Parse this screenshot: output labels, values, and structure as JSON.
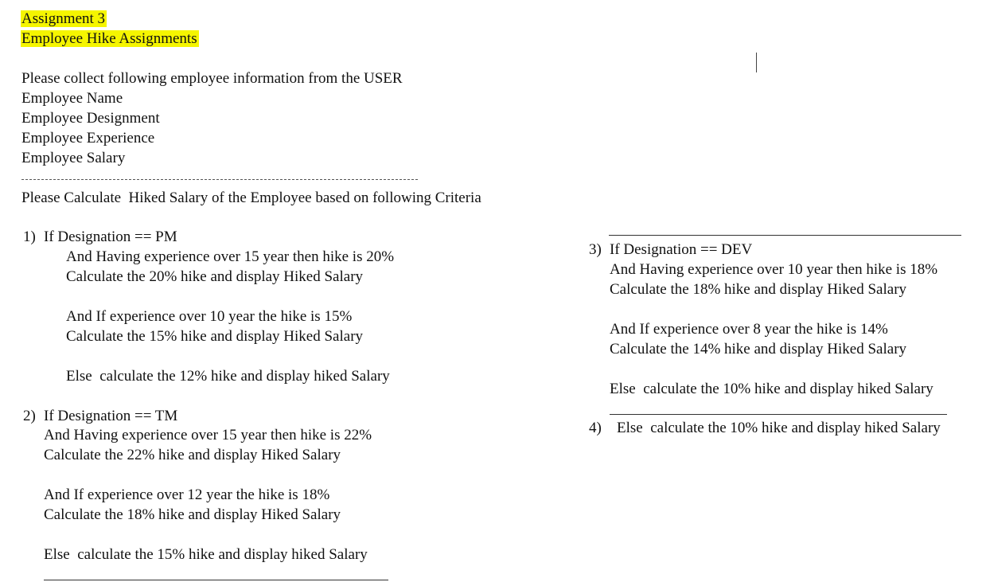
{
  "title": {
    "line1": "Assignment 3",
    "line2": "Employee Hike Assignments"
  },
  "intro": {
    "prompt": "Please collect following employee information from the USER",
    "fields": [
      "Employee Name",
      "Employee Designment",
      "Employee Experience",
      "Employee Salary"
    ],
    "separator": "---------------------------------------------------------------------------------",
    "criteria": "Please Calculate  Hiked Salary of the Employee based on following Criteria"
  },
  "rules": {
    "r1": {
      "num": "1)",
      "head": "If Designation == PM",
      "l1": "And Having experience over 15 year then hike is 20%",
      "l2": "Calculate the 20% hike and display Hiked Salary",
      "l3": "And If experience over 10 year the hike is 15%",
      "l4": "Calculate the 15% hike and display Hiked Salary",
      "l5": "Else  calculate the 12% hike and display hiked Salary"
    },
    "r2": {
      "num": "2)",
      "head": "If Designation == TM",
      "l1": "And Having experience over 15 year then hike is 22%",
      "l2": "Calculate the 22% hike and display Hiked Salary",
      "l3": "And If experience over 12 year the hike is 18%",
      "l4": "Calculate the 18% hike and display Hiked Salary",
      "l5": "Else  calculate the 15% hike and display hiked Salary"
    },
    "r3": {
      "num": "3)",
      "head": "If Designation == DEV",
      "l1": "And Having experience over 10 year then hike is 18%",
      "l2": "Calculate the 18% hike and display Hiked Salary",
      "l3": "And If experience over 8 year the hike is 14%",
      "l4": "Calculate the 14% hike and display Hiked Salary",
      "l5": "Else  calculate the 10% hike and display hiked Salary"
    },
    "r4": {
      "num": "4)",
      "head": "Else  calculate the 10% hike and display hiked Salary"
    }
  }
}
